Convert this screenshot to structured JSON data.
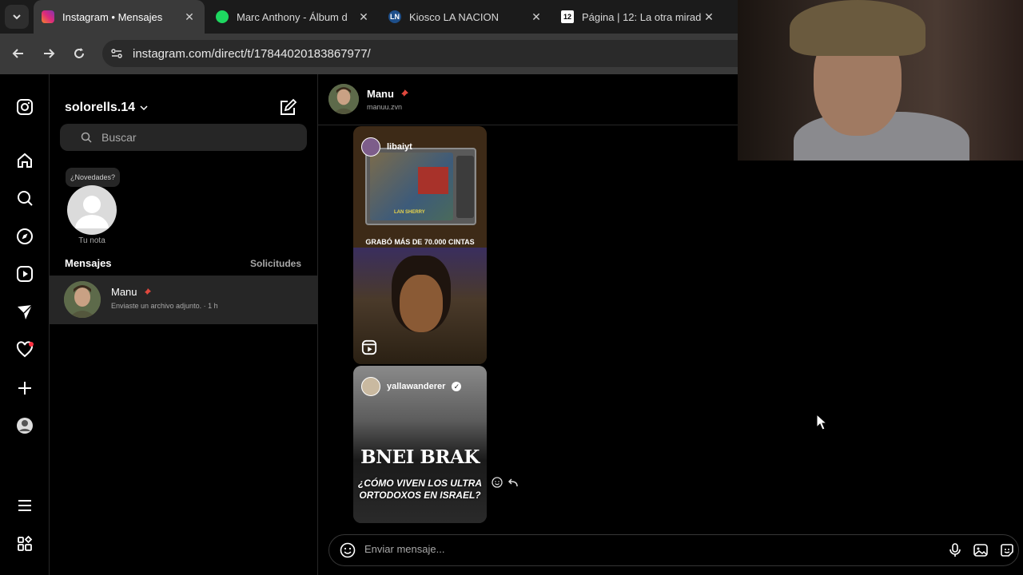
{
  "browser": {
    "tabs": [
      {
        "title": "Instagram • Mensajes",
        "active": true,
        "favicon": "instagram-icon"
      },
      {
        "title": "Marc Anthony - Álbum d",
        "active": false,
        "favicon": "spotify-icon"
      },
      {
        "title": "Kiosco LA NACION",
        "active": false,
        "favicon": "ln-icon",
        "badge": "LN"
      },
      {
        "title": "Página | 12: La otra mirad",
        "active": false,
        "favicon": "pagina12-icon",
        "badge": "12"
      }
    ],
    "close_glyph": "✕",
    "url": "instagram.com/direct/t/17844020183867977/"
  },
  "sidebar_rail": {
    "icons": [
      "instagram-logo-icon",
      "home-icon",
      "search-icon",
      "explore-icon",
      "reels-icon",
      "messages-icon",
      "notifications-icon",
      "create-icon",
      "profile-icon",
      "menu-icon",
      "more-apps-icon"
    ]
  },
  "inbox": {
    "username": "solorells.14",
    "search_placeholder": "Buscar",
    "note_bubble": "¿Novedades?",
    "note_label": "Tu nota",
    "section_title": "Mensajes",
    "requests_label": "Solicitudes",
    "conversations": [
      {
        "name": "Manu",
        "preview": "Enviaste un archivo adjunto. · 1 h"
      }
    ]
  },
  "chat": {
    "name": "Manu",
    "handle": "manuu.zvn",
    "messages": [
      {
        "user": "libaiyt",
        "caption": "GRABÓ MÁS DE 70.000 CINTAS"
      },
      {
        "user": "yallawanderer",
        "verified": true,
        "title": "BNEI BRAK",
        "subtitle": "¿CÓMO VIVEN LOS ULTRA ORTODOXOS EN ISRAEL?"
      }
    ],
    "composer_placeholder": "Enviar mensaje...",
    "tv_label": "LAN SHERRY"
  },
  "colors": {
    "accent": "#0095f6",
    "pin": "#e0483d",
    "notification_dot": "#ff3040"
  }
}
